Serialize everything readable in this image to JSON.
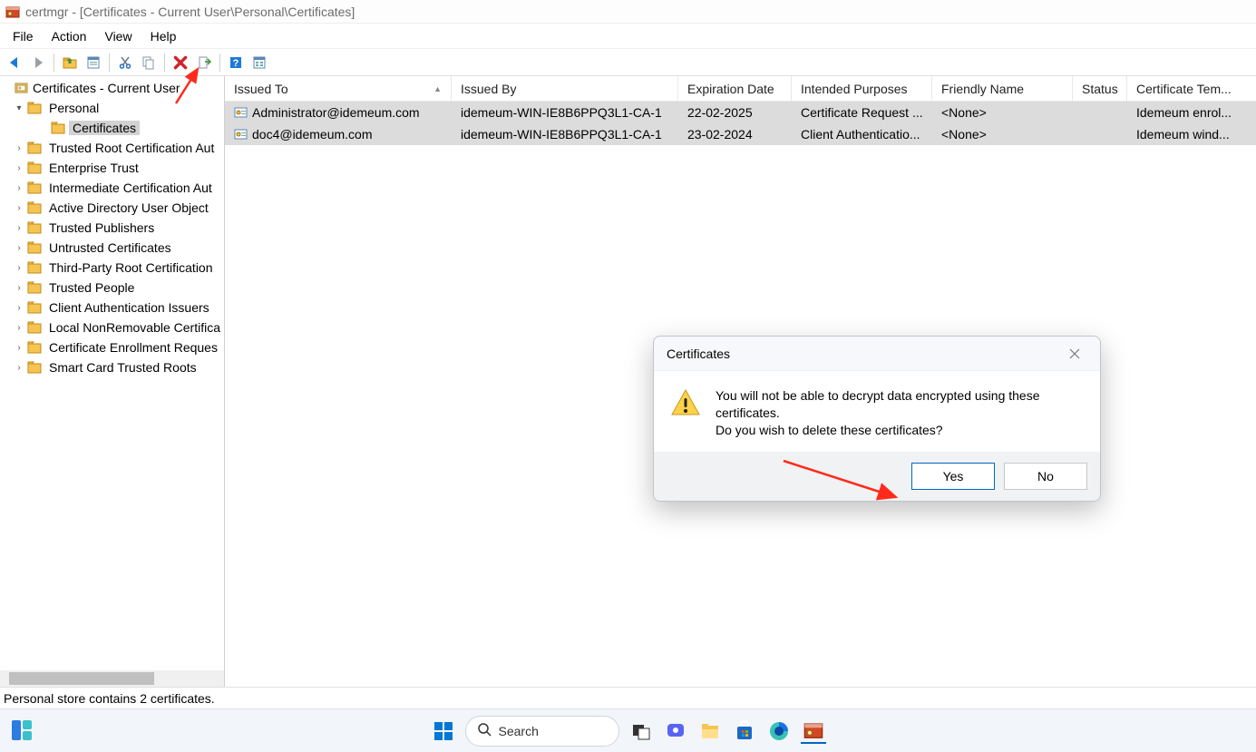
{
  "window": {
    "title": "certmgr - [Certificates - Current User\\Personal\\Certificates]"
  },
  "menu": {
    "file": "File",
    "action": "Action",
    "view": "View",
    "help": "Help"
  },
  "tree": {
    "root": "Certificates - Current User",
    "items": [
      {
        "label": "Personal",
        "expanded": true,
        "children": [
          {
            "label": "Certificates",
            "selected": true
          }
        ]
      },
      {
        "label": "Trusted Root Certification Aut"
      },
      {
        "label": "Enterprise Trust"
      },
      {
        "label": "Intermediate Certification Aut"
      },
      {
        "label": "Active Directory User Object"
      },
      {
        "label": "Trusted Publishers"
      },
      {
        "label": "Untrusted Certificates"
      },
      {
        "label": "Third-Party Root Certification"
      },
      {
        "label": "Trusted People"
      },
      {
        "label": "Client Authentication Issuers"
      },
      {
        "label": "Local NonRemovable Certifica"
      },
      {
        "label": "Certificate Enrollment Reques"
      },
      {
        "label": "Smart Card Trusted Roots"
      }
    ]
  },
  "columns": {
    "issuedTo": "Issued To",
    "issuedBy": "Issued By",
    "expiration": "Expiration Date",
    "purposes": "Intended Purposes",
    "friendly": "Friendly Name",
    "status": "Status",
    "template": "Certificate Tem..."
  },
  "rows": [
    {
      "issuedTo": "Administrator@idemeum.com",
      "issuedBy": "idemeum-WIN-IE8B6PPQ3L1-CA-1",
      "expiration": "22-02-2025",
      "purposes": "Certificate Request ...",
      "friendly": "<None>",
      "status": "",
      "template": "Idemeum enrol..."
    },
    {
      "issuedTo": "doc4@idemeum.com",
      "issuedBy": "idemeum-WIN-IE8B6PPQ3L1-CA-1",
      "expiration": "23-02-2024",
      "purposes": "Client Authenticatio...",
      "friendly": "<None>",
      "status": "",
      "template": "Idemeum wind..."
    }
  ],
  "statusbar": "Personal store contains 2 certificates.",
  "dialog": {
    "title": "Certificates",
    "line1": "You will not be able to decrypt data encrypted using these certificates.",
    "line2": "Do you wish to delete these certificates?",
    "yes": "Yes",
    "no": "No"
  },
  "taskbar": {
    "search": "Search"
  }
}
